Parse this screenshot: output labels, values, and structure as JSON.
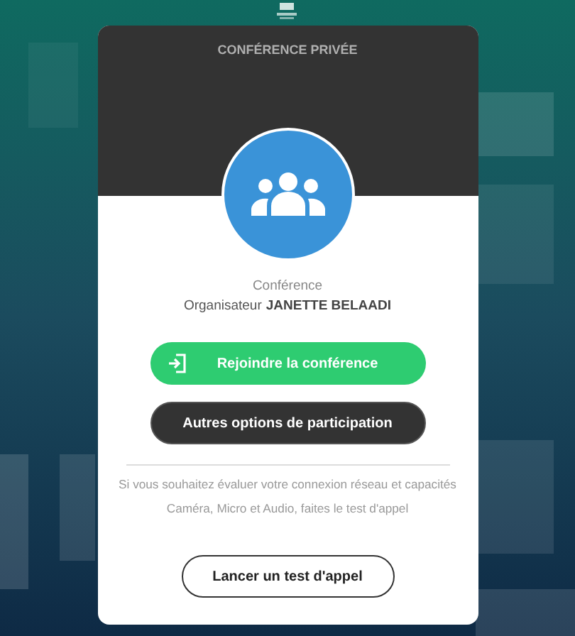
{
  "dialog": {
    "title": "CONFÉRENCE PRIVÉE",
    "label": "Conférence",
    "organizer_label": "Organisateur",
    "organizer_name": "JANETTE BELAADI"
  },
  "buttons": [
    {
      "kind": "primary",
      "label": "Rejoindre la conférence"
    },
    {
      "kind": "dark",
      "label": "Autres options de participation"
    }
  ],
  "hint": "Si vous souhaitez évaluer votre connexion réseau et capacités Caméra, Micro et Audio, faites le test d'appel",
  "test_button": {
    "label": "Lancer un test d'appel"
  }
}
